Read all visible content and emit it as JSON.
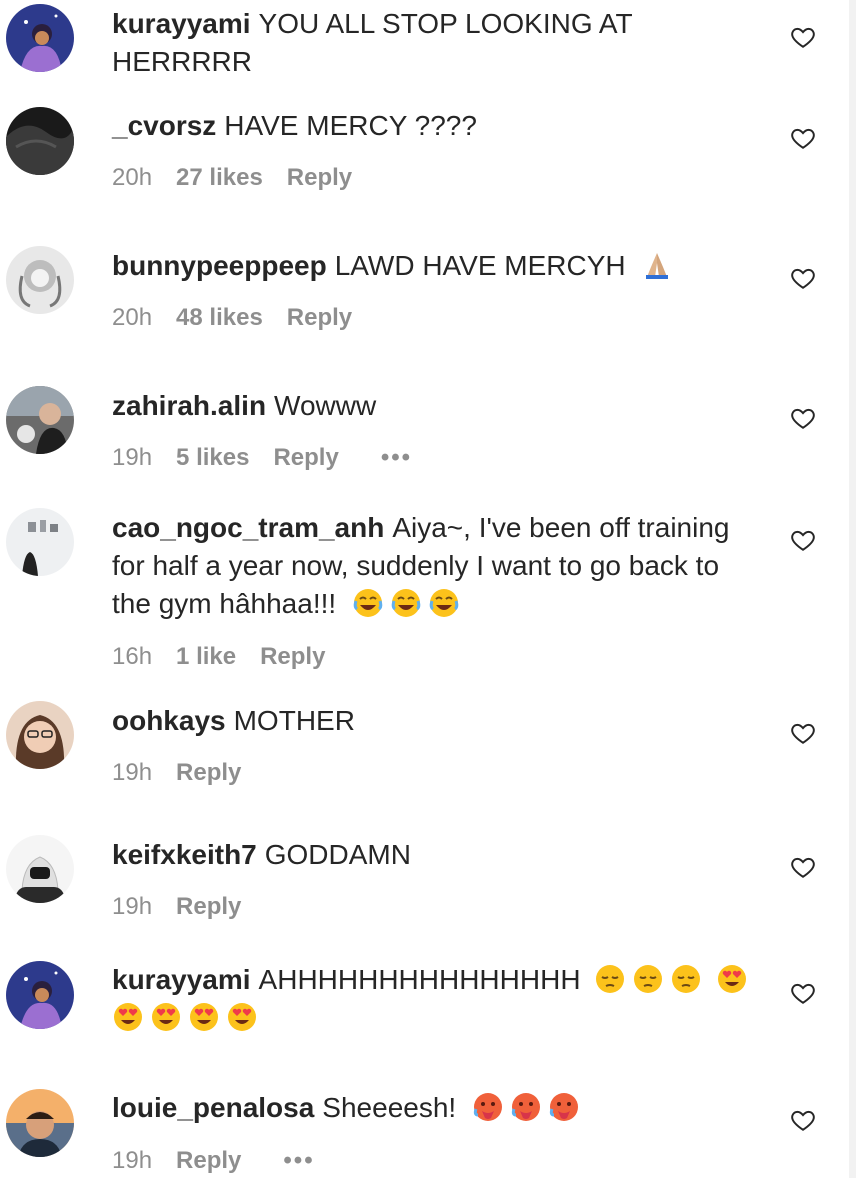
{
  "comments": [
    {
      "user": "kurayyami",
      "text": "YOU ALL STOP LOOKING AT HERRRRR"
    },
    {
      "user": "_cvorsz",
      "text": "HAVE MERCY ????",
      "time": "20h",
      "likes": "27 likes",
      "reply": "Reply"
    },
    {
      "user": "bunnypeeppeep",
      "text": "LAWD HAVE MERCYH",
      "emoji": [
        "folded-hands-emoji"
      ],
      "time": "20h",
      "likes": "48 likes",
      "reply": "Reply"
    },
    {
      "user": "zahirah.alin",
      "text": "Wowww",
      "time": "19h",
      "likes": "5 likes",
      "reply": "Reply",
      "more": "•••"
    },
    {
      "user": "cao_ngoc_tram_anh",
      "text": "Aiya~, I've been off training for half a year now, suddenly I want to go back to the gym hâhhaa!!!",
      "emoji": [
        "joy-emoji",
        "joy-emoji",
        "joy-emoji"
      ],
      "time": "16h",
      "likes": "1 like",
      "reply": "Reply"
    },
    {
      "user": "oohkays",
      "text": "MOTHER",
      "time": "19h",
      "reply": "Reply"
    },
    {
      "user": "keifxkeith7",
      "text": "GODDAMN",
      "time": "19h",
      "reply": "Reply"
    },
    {
      "user": "kurayyami",
      "text": "AHHHHHHHHHHHHHHH",
      "emoji": [
        "pensive-emoji",
        "pensive-emoji",
        "pensive-emoji",
        "heart-eyes-emoji",
        "heart-eyes-emoji",
        "heart-eyes-emoji",
        "heart-eyes-emoji",
        "heart-eyes-emoji"
      ]
    },
    {
      "user": "louie_penalosa",
      "text": "Sheeeesh!",
      "emoji": [
        "hot-face-emoji",
        "hot-face-emoji",
        "hot-face-emoji"
      ],
      "time": "19h",
      "reply": "Reply",
      "more": "•••"
    }
  ],
  "colors": {
    "text": "#262626",
    "meta": "#8e8e8e",
    "background": "#ffffff"
  }
}
